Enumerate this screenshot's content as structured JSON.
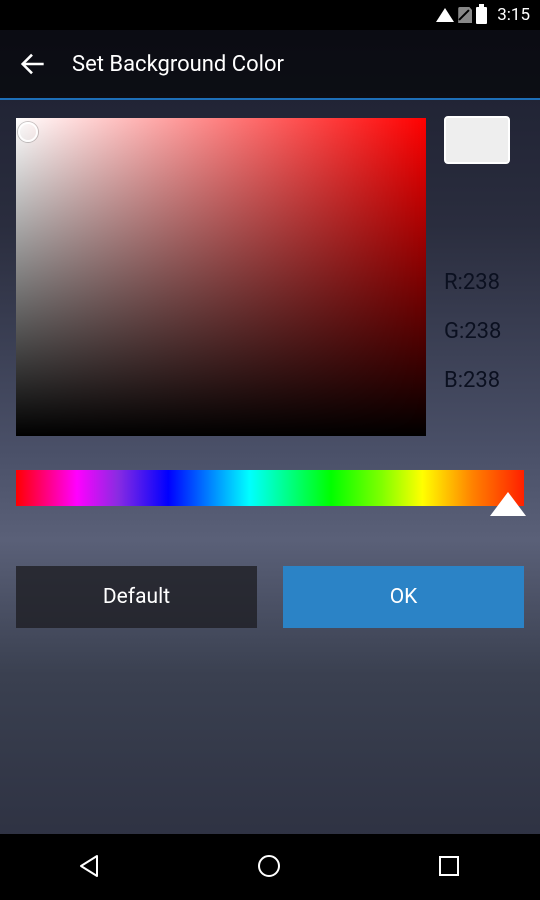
{
  "status": {
    "time": "3:15"
  },
  "header": {
    "title": "Set Background Color"
  },
  "color": {
    "swatch_hex": "eeeeee",
    "r_label": "R:238",
    "g_label": "G:238",
    "b_label": "B:238"
  },
  "buttons": {
    "default_label": "Default",
    "ok_label": "OK"
  }
}
